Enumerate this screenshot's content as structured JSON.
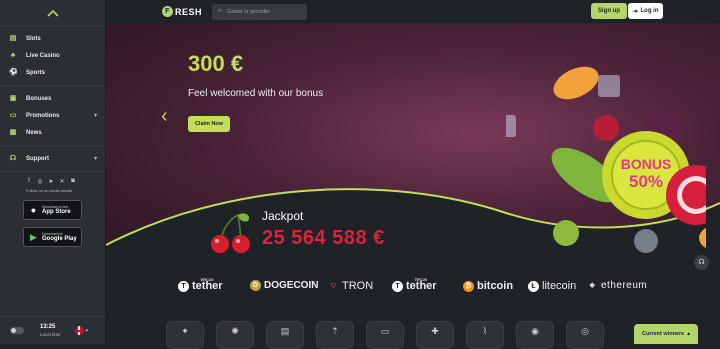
{
  "sidebar": {
    "items": [
      {
        "label": "Slots",
        "icon": "slots-icon"
      },
      {
        "label": "Live Casino",
        "icon": "live-casino-icon"
      },
      {
        "label": "Sports",
        "icon": "sports-icon"
      },
      {
        "label": "Bonuses",
        "icon": "gift-icon"
      },
      {
        "label": "Promotions",
        "icon": "promotions-icon"
      },
      {
        "label": "News",
        "icon": "news-icon"
      },
      {
        "label": "Support",
        "icon": "support-icon"
      }
    ],
    "follow_text": "Follow us on social media",
    "app_store": {
      "small": "Download on the",
      "big": "App Store"
    },
    "google_play": {
      "small": "Download for",
      "big": "Google Play"
    },
    "time": "13:25",
    "time_label": "Local time"
  },
  "topbar": {
    "brand": "RESH",
    "search_placeholder": "Game or provider",
    "signup_label": "Sign up",
    "login_label": "Log in"
  },
  "hero": {
    "amount": "300 €",
    "subtitle": "Feel welcomed with our bonus",
    "claim_label": "Claim Now",
    "chip_text_1": "BONUS",
    "chip_text_2": "50%",
    "jackpot_label": "Jackpot",
    "jackpot_value": "25 564 588 €"
  },
  "partners": [
    "tether",
    "DOGECOIN",
    "TRON",
    "tether",
    "bitcoin",
    "litecoin",
    "ethereum"
  ],
  "partner_badges": [
    "ERC20",
    "TRC20"
  ],
  "winners_label": "Current winners",
  "colors": {
    "accent": "#b3d66a",
    "jackpot": "#e0203c",
    "background": "#1f2226"
  }
}
